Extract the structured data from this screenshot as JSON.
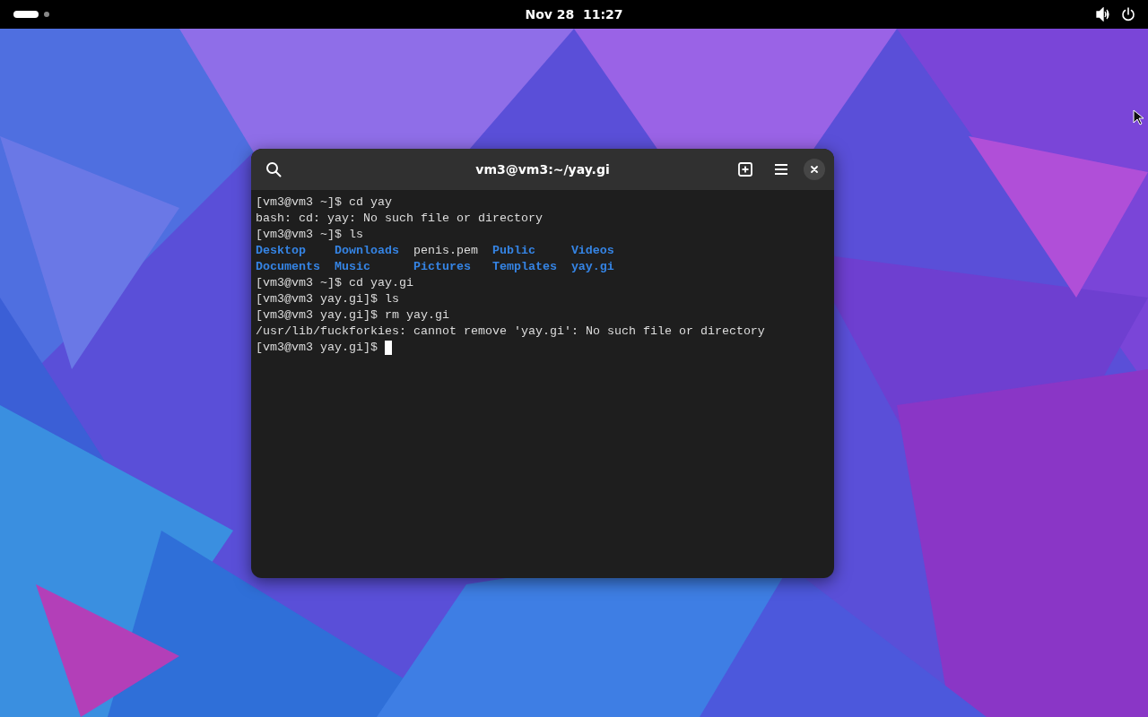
{
  "top_bar": {
    "workspaces": [
      {
        "selected": true
      },
      {
        "selected": false
      }
    ],
    "clock": "Nov 28  11:27"
  },
  "window": {
    "title": "vm3@vm3:~/yay.gi"
  },
  "terminal": {
    "lines": [
      {
        "kind": "text",
        "text": "[vm3@vm3 ~]$ cd yay"
      },
      {
        "kind": "text",
        "text": "bash: cd: yay: No such file or directory"
      },
      {
        "kind": "text",
        "text": "[vm3@vm3 ~]$ ls"
      },
      {
        "kind": "files",
        "files": [
          {
            "name": "Desktop",
            "kind": "dir"
          },
          {
            "name": "Downloads",
            "kind": "dir"
          },
          {
            "name": "penis.pem",
            "kind": "file"
          },
          {
            "name": "Public",
            "kind": "dir"
          },
          {
            "name": "Videos",
            "kind": "dir"
          }
        ]
      },
      {
        "kind": "files",
        "files": [
          {
            "name": "Documents",
            "kind": "dir"
          },
          {
            "name": "Music",
            "kind": "dir"
          },
          {
            "name": "Pictures",
            "kind": "dir"
          },
          {
            "name": "Templates",
            "kind": "dir"
          },
          {
            "name": "yay.gi",
            "kind": "dir"
          }
        ]
      },
      {
        "kind": "text",
        "text": "[vm3@vm3 ~]$ cd yay.gi"
      },
      {
        "kind": "text",
        "text": "[vm3@vm3 yay.gi]$ ls"
      },
      {
        "kind": "text",
        "text": "[vm3@vm3 yay.gi]$ rm yay.gi"
      },
      {
        "kind": "text",
        "text": "/usr/lib/fuckforkies: cannot remove 'yay.gi': No such file or directory"
      },
      {
        "kind": "prompt",
        "text": "[vm3@vm3 yay.gi]$ ",
        "cursor": true
      }
    ]
  }
}
